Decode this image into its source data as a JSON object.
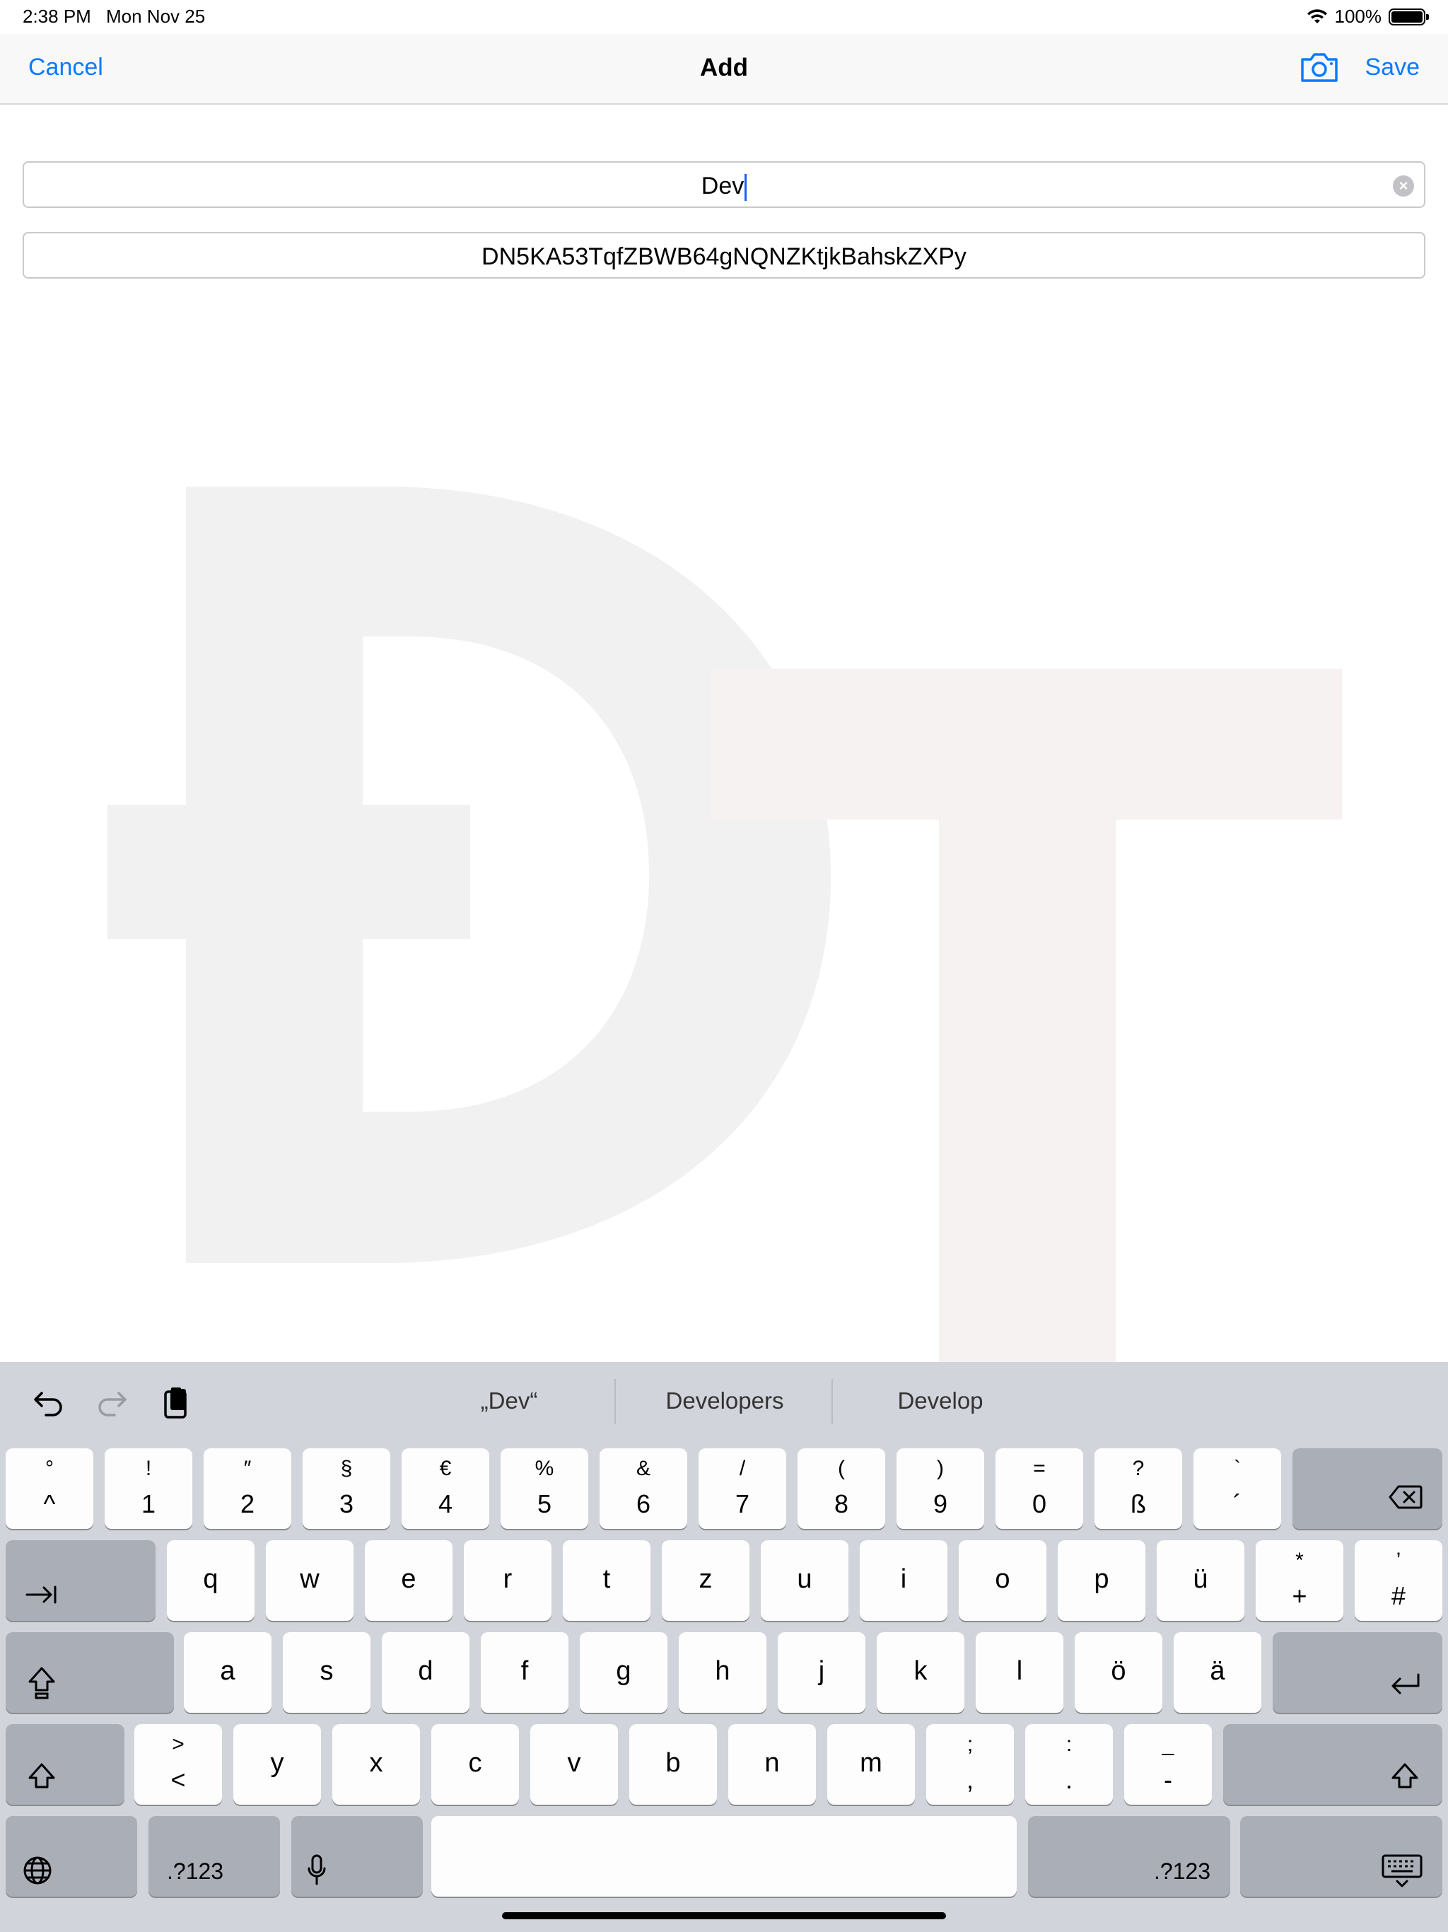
{
  "status_bar": {
    "time": "2:38 PM",
    "date": "Mon Nov 25",
    "battery": "100%"
  },
  "nav": {
    "cancel": "Cancel",
    "title": "Add",
    "camera_icon": "camera-icon",
    "save": "Save"
  },
  "fields": {
    "name_value": "Dev",
    "address_value": "DN5KA53TqfZBWB64gNQNZKtjkBahskZXPy"
  },
  "keyboard": {
    "suggestions": [
      "„Dev“",
      "Developers",
      "Develop"
    ],
    "number_row": [
      {
        "top": "°",
        "bottom": "^"
      },
      {
        "top": "!",
        "bottom": "1"
      },
      {
        "top": "″",
        "bottom": "2"
      },
      {
        "top": "§",
        "bottom": "3"
      },
      {
        "top": "€",
        "bottom": "4"
      },
      {
        "top": "%",
        "bottom": "5"
      },
      {
        "top": "&",
        "bottom": "6"
      },
      {
        "top": "/",
        "bottom": "7"
      },
      {
        "top": "(",
        "bottom": "8"
      },
      {
        "top": ")",
        "bottom": "9"
      },
      {
        "top": "=",
        "bottom": "0"
      },
      {
        "top": "?",
        "bottom": "ß"
      },
      {
        "top": "`",
        "bottom": "´"
      }
    ],
    "row_q": [
      "q",
      "w",
      "e",
      "r",
      "t",
      "z",
      "u",
      "i",
      "o",
      "p",
      "ü"
    ],
    "row_q_extra": [
      {
        "top": "*",
        "bottom": "+"
      },
      {
        "top": "’",
        "bottom": "#"
      }
    ],
    "row_a": [
      "a",
      "s",
      "d",
      "f",
      "g",
      "h",
      "j",
      "k",
      "l",
      "ö",
      "ä"
    ],
    "row_y_first": {
      "top": ">",
      "bottom": "<"
    },
    "row_y": [
      "y",
      "x",
      "c",
      "v",
      "b",
      "n",
      "m"
    ],
    "row_y_extra": [
      {
        "top": ";",
        "bottom": ","
      },
      {
        "top": ":",
        "bottom": "."
      },
      {
        "top": "_",
        "bottom": "-"
      }
    ],
    "mode_left": ".?123",
    "mode_right": ".?123"
  }
}
